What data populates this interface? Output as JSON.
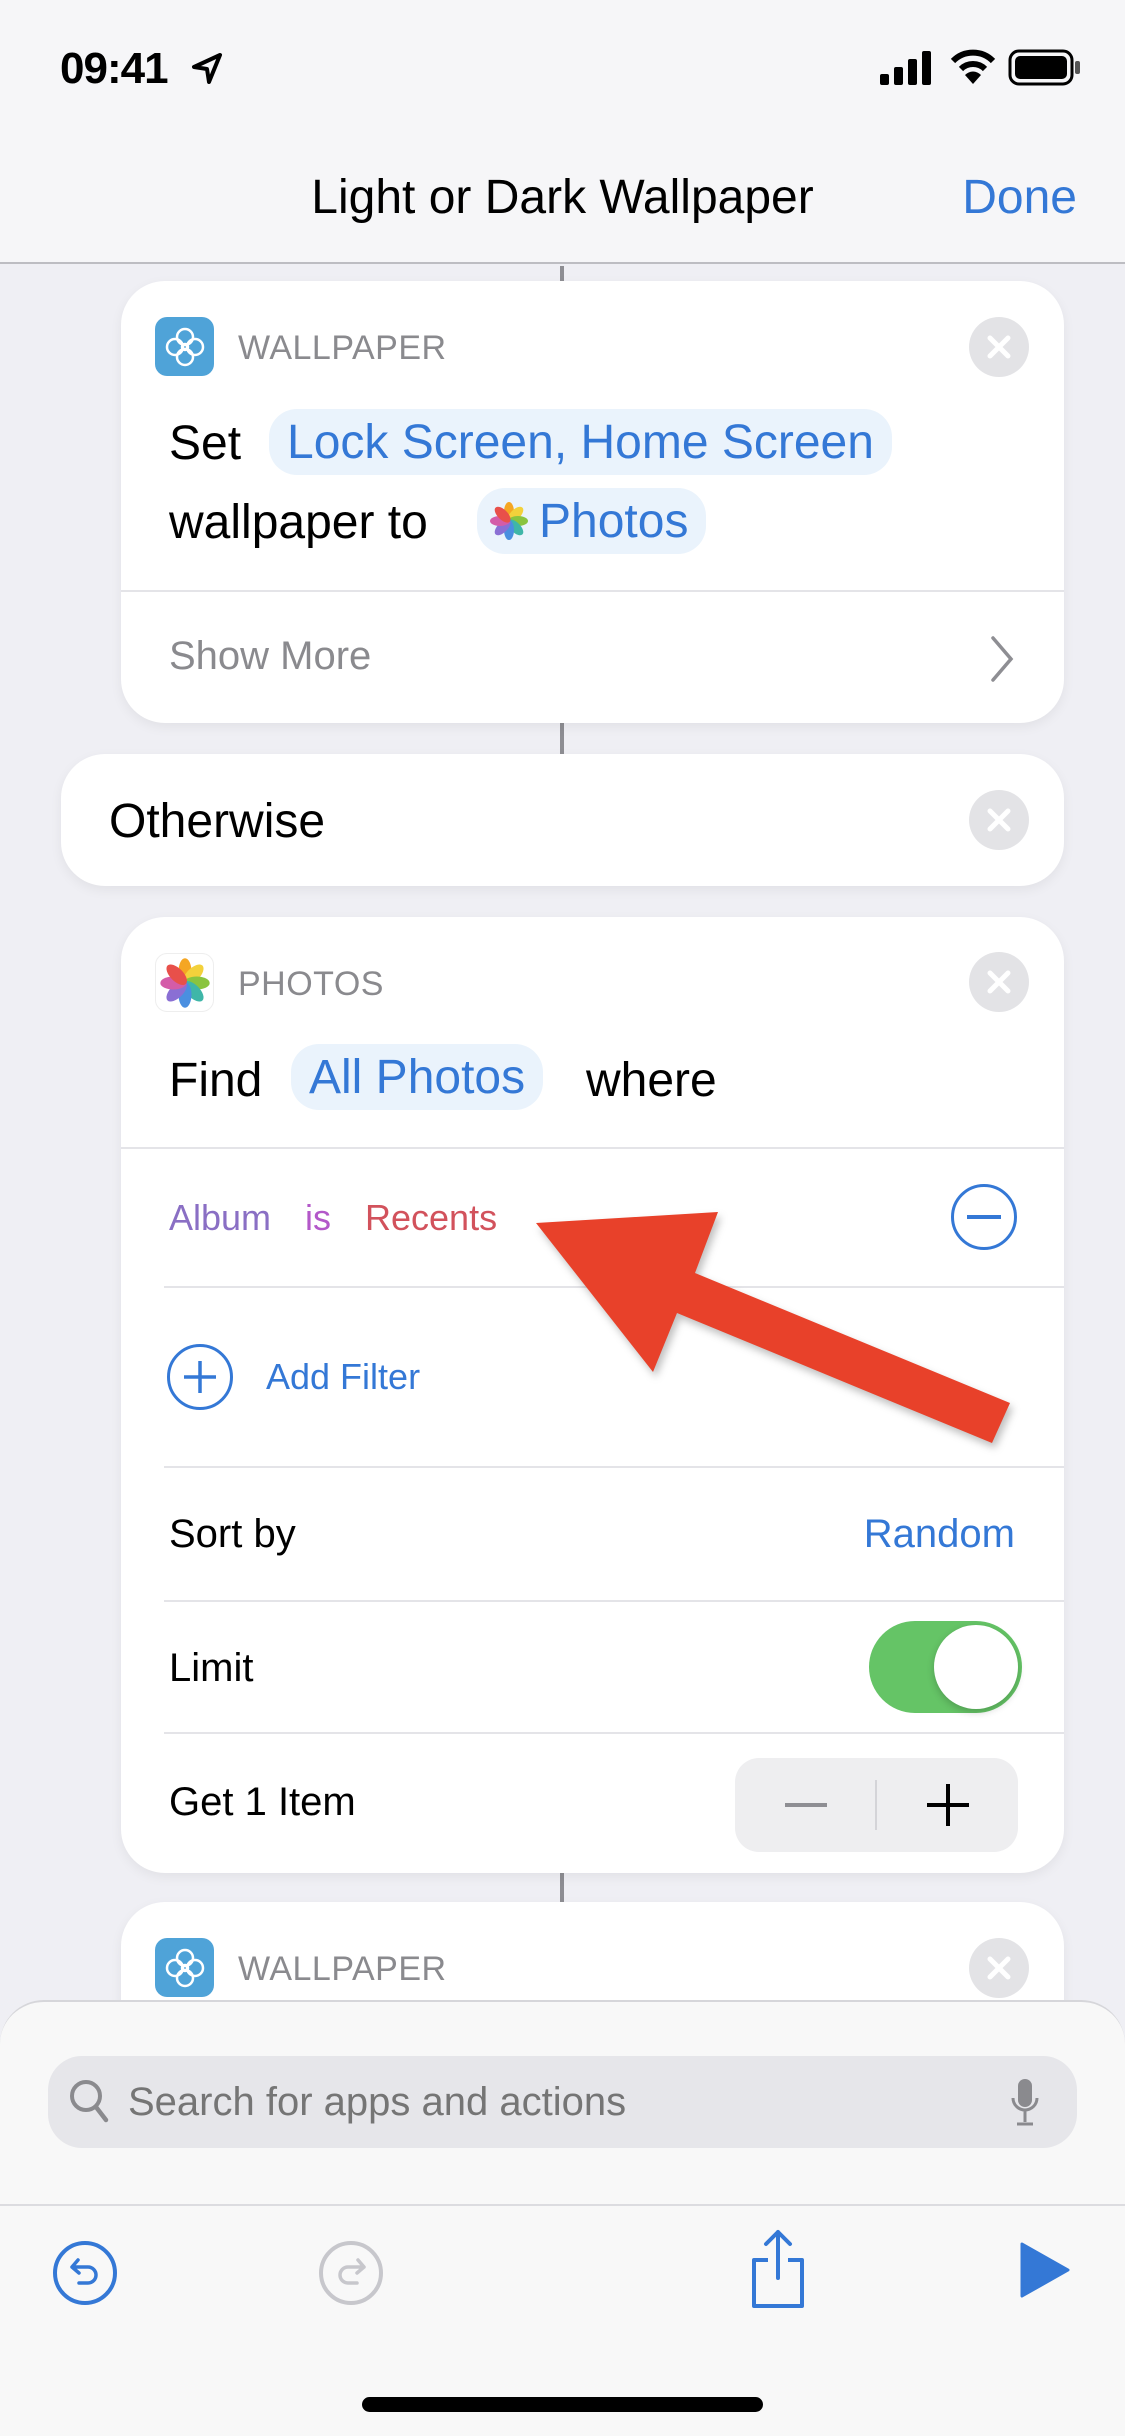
{
  "status_bar": {
    "time": "09:41",
    "icons": [
      "location-arrow-icon",
      "cellular-signal-icon",
      "wifi-icon",
      "battery-icon"
    ]
  },
  "nav": {
    "title": "Light or Dark Wallpaper",
    "done_label": "Done"
  },
  "card1": {
    "app_label": "WALLPAPER",
    "verb": "Set",
    "target_chip": "Lock Screen, Home Screen",
    "middle": "wallpaper to",
    "source_chip": "Photos",
    "show_more": "Show More"
  },
  "otherwise": {
    "label": "Otherwise"
  },
  "photos_card": {
    "app_label": "PHOTOS",
    "find": "Find",
    "find_chip": "All Photos",
    "where": "where",
    "filter": {
      "property": "Album",
      "operator": "is",
      "value": "Recents"
    },
    "add_filter": "Add Filter",
    "sort_label": "Sort by",
    "sort_value": "Random",
    "limit_label": "Limit",
    "limit_on": true,
    "get_label": "Get 1 Item"
  },
  "card3": {
    "app_label": "WALLPAPER"
  },
  "bottom_sheet": {
    "search_placeholder": "Search for apps and actions"
  },
  "toolbar": {
    "icons": [
      "undo-icon",
      "redo-icon",
      "share-icon",
      "play-icon"
    ]
  },
  "colors": {
    "accent": "#3478d6",
    "toggle_on": "#65c466",
    "annotation_arrow": "#e8412a",
    "filter_property": "#8a6fc4",
    "filter_operator": "#b358c9",
    "filter_value": "#d2525c",
    "wallpaper_icon": "#4fa3d8"
  }
}
